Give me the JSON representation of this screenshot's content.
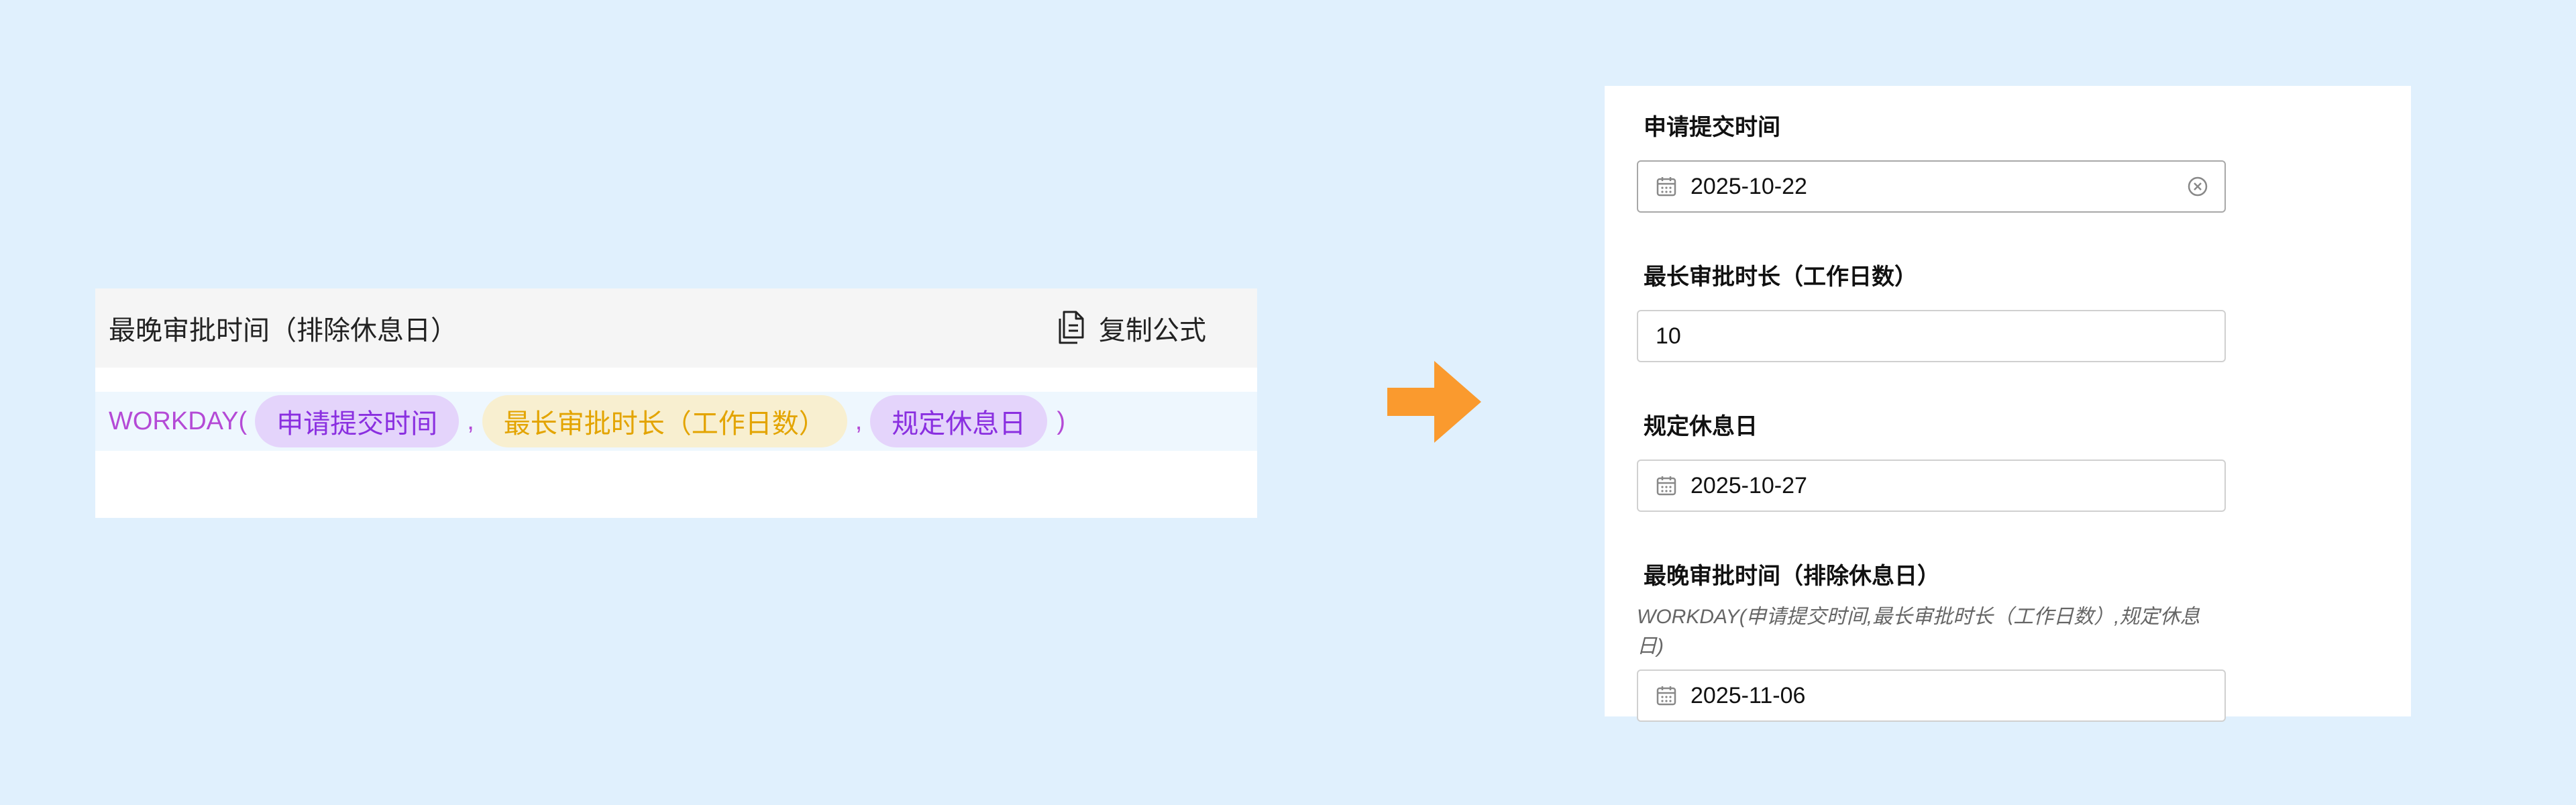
{
  "formula_editor": {
    "title": "最晚审批时间（排除休息日）",
    "copy_label": "复制公式",
    "function_open": "WORKDAY(",
    "separator": ",",
    "function_close": ")",
    "args": [
      {
        "label": "申请提交时间",
        "color": "purple"
      },
      {
        "label": "最长审批时长（工作日数）",
        "color": "yellow"
      },
      {
        "label": "规定休息日",
        "color": "purple"
      }
    ]
  },
  "form": {
    "fields": [
      {
        "label": "申请提交时间",
        "value": "2025-10-22",
        "icon": "calendar-icon",
        "clearable": true
      },
      {
        "label": "最长审批时长（工作日数）",
        "value": "10"
      },
      {
        "label": "规定休息日",
        "value": "2025-10-27",
        "icon": "calendar-icon"
      },
      {
        "label": "最晚审批时间（排除休息日）",
        "formula": "WORKDAY(申请提交时间,最长审批时长（工作日数）,规定休息日)",
        "value": "2025-11-06",
        "icon": "calendar-icon"
      }
    ]
  },
  "colors": {
    "background": "#e0f0fd",
    "function_text": "#b44ad6",
    "pill_purple_bg": "#e4d4fb",
    "pill_purple_text": "#8a2fe0",
    "pill_yellow_bg": "#f8efd0",
    "pill_yellow_text": "#e3a400",
    "arrow": "#fa9a2e"
  }
}
